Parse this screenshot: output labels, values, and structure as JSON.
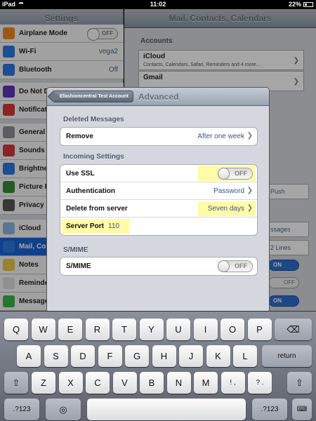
{
  "status": {
    "carrier": "iPad",
    "time": "11:02",
    "battery": "22%"
  },
  "left": {
    "title": "Settings",
    "rows": [
      {
        "label": "Airplane Mode",
        "switch": "OFF",
        "icon": "airplane-icon",
        "color": "#ef8a1e"
      },
      {
        "label": "Wi-Fi",
        "value": "vega2",
        "icon": "wifi-icon",
        "color": "#2d78e0"
      },
      {
        "label": "Bluetooth",
        "value": "Off",
        "icon": "bluetooth-icon",
        "color": "#2d78e0"
      },
      {
        "label": "Do Not Di",
        "icon": "moon-icon",
        "color": "#5a37b8"
      },
      {
        "label": "Notificati",
        "icon": "notifications-icon",
        "color": "#d63a3a"
      },
      {
        "label": "General",
        "icon": "gear-icon",
        "color": "#8a8f97"
      },
      {
        "label": "Sounds",
        "icon": "speaker-icon",
        "color": "#d63a3a"
      },
      {
        "label": "Brightne",
        "icon": "brightness-icon",
        "color": "#2d78e0"
      },
      {
        "label": "Picture F",
        "icon": "picture-icon",
        "color": "#3a8a3a"
      },
      {
        "label": "Privacy",
        "icon": "hand-icon",
        "color": "#555"
      },
      {
        "label": "iCloud",
        "icon": "cloud-icon",
        "color": "#8ab6e0"
      },
      {
        "label": "Mail, Co",
        "icon": "mail-icon",
        "color": "#2d78e0",
        "selected": true
      },
      {
        "label": "Notes",
        "icon": "notes-icon",
        "color": "#e8c84a"
      },
      {
        "label": "Reminde",
        "icon": "reminders-icon",
        "color": "#ddd"
      },
      {
        "label": "Message",
        "icon": "messages-icon",
        "color": "#3ab54a"
      }
    ]
  },
  "right": {
    "title": "Mail, Contacts, Calendars",
    "accounts_header": "Accounts",
    "accounts": [
      {
        "name": "iCloud",
        "desc": "Contacts, Calendars, Safari, Reminders and 4 more..."
      },
      {
        "name": "Gmail"
      }
    ],
    "peek": {
      "push": "Push",
      "messages": "ssages",
      "lines": "2 Lines",
      "on": "ON",
      "off": "OFF"
    }
  },
  "popover": {
    "back_label": "Efashioncentral Test Account",
    "title": "Advanced",
    "deleted_header": "Deleted Messages",
    "remove_label": "Remove",
    "remove_value": "After one week",
    "incoming_header": "Incoming Settings",
    "ssl_label": "Use SSL",
    "ssl_state": "OFF",
    "auth_label": "Authentication",
    "auth_value": "Password",
    "delete_label": "Delete from server",
    "delete_value": "Seven days",
    "port_label": "Server Port",
    "port_value": "110",
    "smime_header": "S/MIME",
    "smime_label": "S/MIME",
    "smime_state": "OFF"
  },
  "keyboard": {
    "row1": [
      "Q",
      "W",
      "E",
      "R",
      "T",
      "Y",
      "U",
      "I",
      "O",
      "P"
    ],
    "row2": [
      "A",
      "S",
      "D",
      "F",
      "G",
      "H",
      "J",
      "K",
      "L"
    ],
    "row3": [
      "Z",
      "X",
      "C",
      "V",
      "B",
      "N",
      "M",
      "!\n,",
      "?\n."
    ],
    "return_label": "return",
    "num_label": ".?123"
  }
}
